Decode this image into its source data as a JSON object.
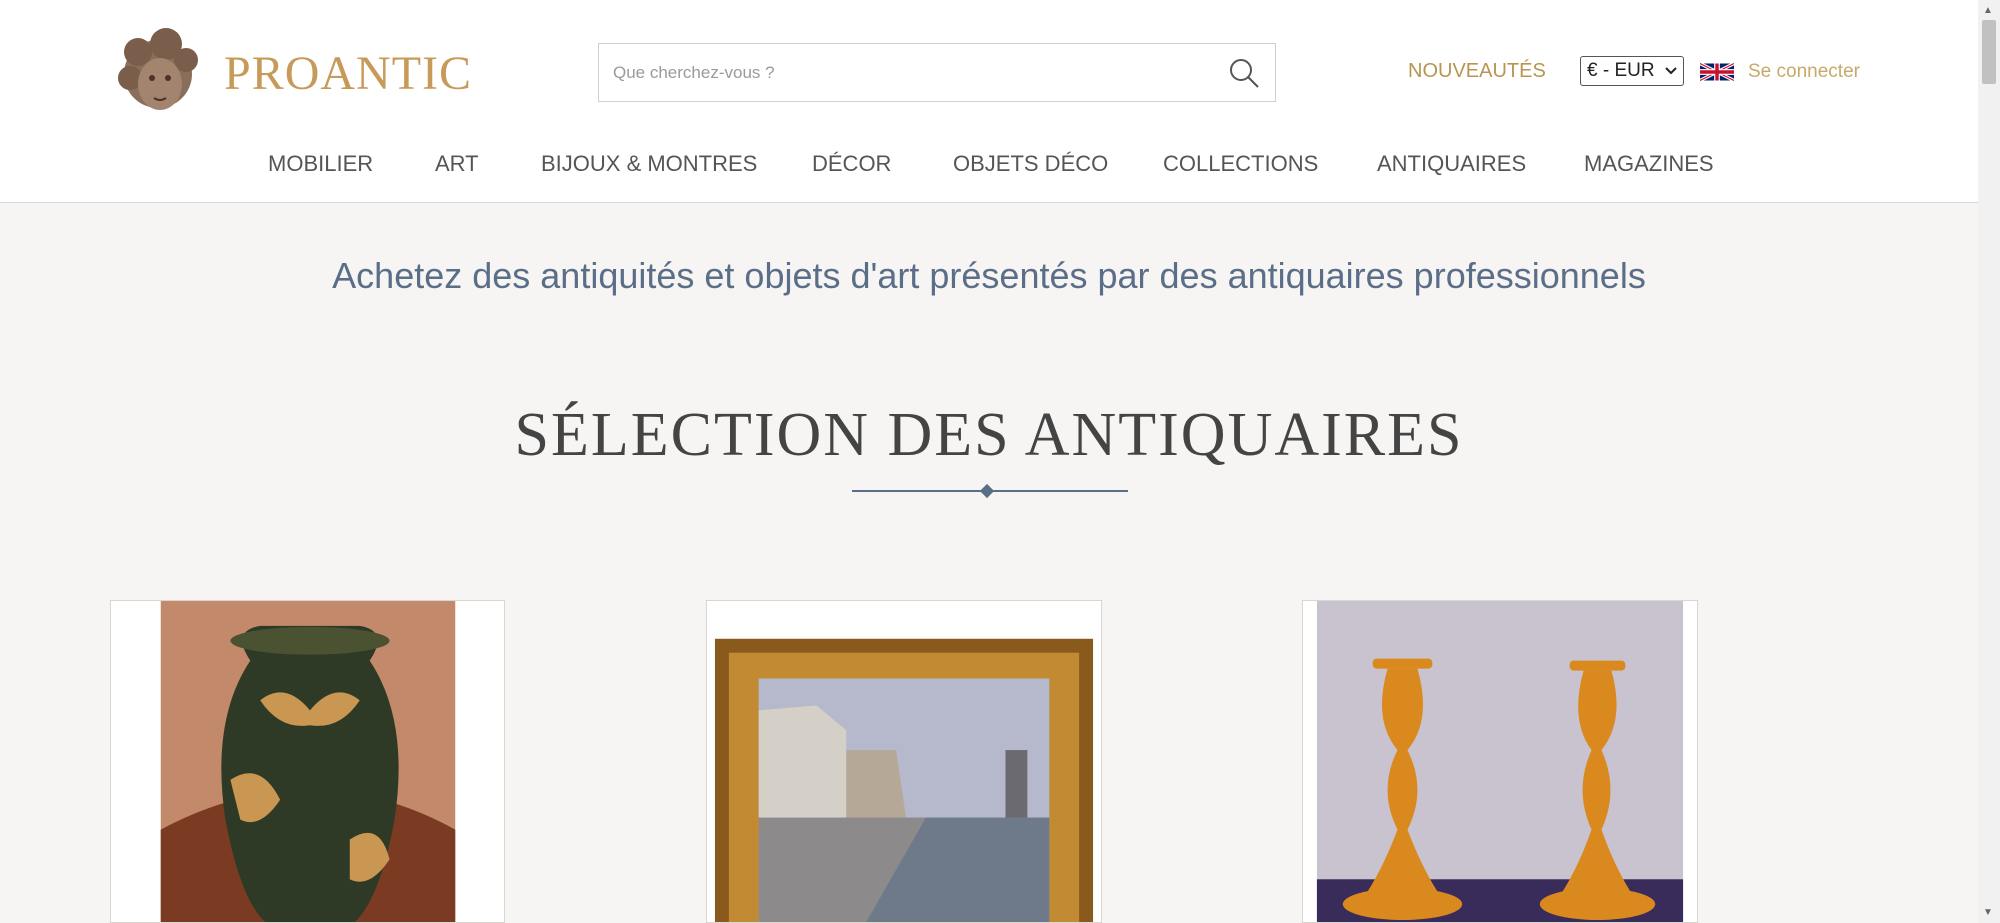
{
  "header": {
    "logo_text": "PROANTIC",
    "search": {
      "placeholder": "Que cherchez-vous ?",
      "value": ""
    },
    "nouveautes_label": "NOUVEAUTÉS",
    "currency_value": "€ - EUR",
    "language_icon": "uk-flag-icon",
    "login_label": "Se connecter",
    "nav": [
      "MOBILIER",
      "ART",
      "BIJOUX & MONTRES",
      "DÉCOR",
      "OBJETS DÉCO",
      "COLLECTIONS",
      "ANTIQUAIRES",
      "MAGAZINES"
    ]
  },
  "main": {
    "tagline": "Achetez des antiquités et objets d'art présentés par des antiquaires professionnels",
    "section_title": "SÉLECTION DES ANTIQUAIRES",
    "products": [
      {
        "icon": "vase-image"
      },
      {
        "icon": "framed-painting-image"
      },
      {
        "icon": "candlesticks-image"
      }
    ]
  },
  "colors": {
    "accent_gold": "#b89550",
    "logo_gold": "#c89a5a",
    "tagline_blue": "#5b6e88",
    "background": "#f6f5f3"
  }
}
